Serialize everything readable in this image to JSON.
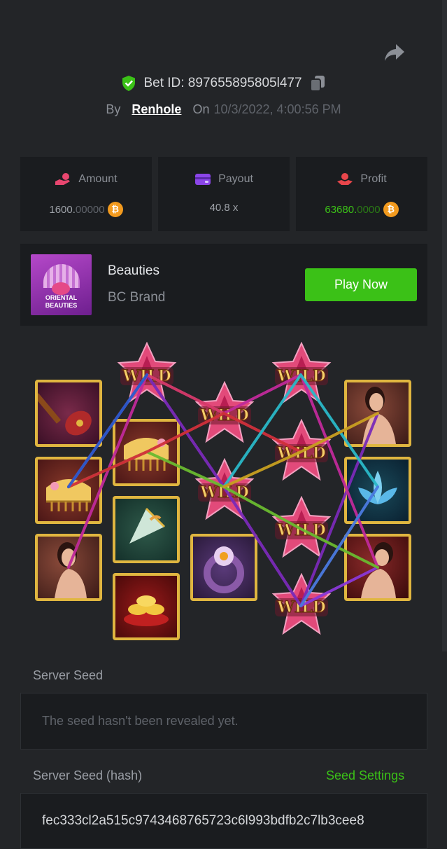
{
  "header": {
    "bet_id": "Bet ID: 897655895805l477",
    "by_label": "By",
    "username": "Renhole",
    "on_label": "On",
    "date": "10/3/2022, 4:00:56 PM"
  },
  "stats": [
    {
      "label": "Amount",
      "value_main": "1600.",
      "value_dim": "00000",
      "value_color": "#9ea2a8",
      "coin": "₿",
      "icon": "hand-coin-icon"
    },
    {
      "label": "Payout",
      "value_main": "40.8 x",
      "value_dim": "",
      "value_color": "#9ea2a8",
      "coin": "",
      "icon": "wallet-icon"
    },
    {
      "label": "Profit",
      "value_main": "63680.",
      "value_dim": "0000",
      "value_color": "#3bc117",
      "coin": "₿",
      "icon": "profit-hand-icon"
    }
  ],
  "game": {
    "thumb_text_1": "ORIENTAL",
    "thumb_text_2": "BEAUTIES",
    "title": "Beauties",
    "brand": "BC Brand",
    "play_label": "Play Now"
  },
  "reels": {
    "wild_label": "WILD",
    "symbols": [
      "pipa-icon",
      "comb-icon",
      "lady-icon",
      "comb-icon",
      "fan-icon",
      "gold-ingot-icon",
      "ring-icon",
      "lady-icon",
      "lotus-icon",
      "lady-icon"
    ]
  },
  "seeds": {
    "server_seed_label": "Server Seed",
    "server_seed_value": "The seed hasn't been revealed yet.",
    "hash_label": "Server Seed (hash)",
    "settings_link": "Seed Settings",
    "hash_value": "fec333cl2a515c9743468765723c6l993bdfb2c7lb3cee8"
  },
  "colors": {
    "accent_green": "#3bc117",
    "background": "#232528",
    "card": "#1a1c1f",
    "shield": "#3bc117",
    "amount_icon": "#e8466f",
    "payout_icon": "#8b45e8",
    "profit_icon": "#e8464b"
  }
}
